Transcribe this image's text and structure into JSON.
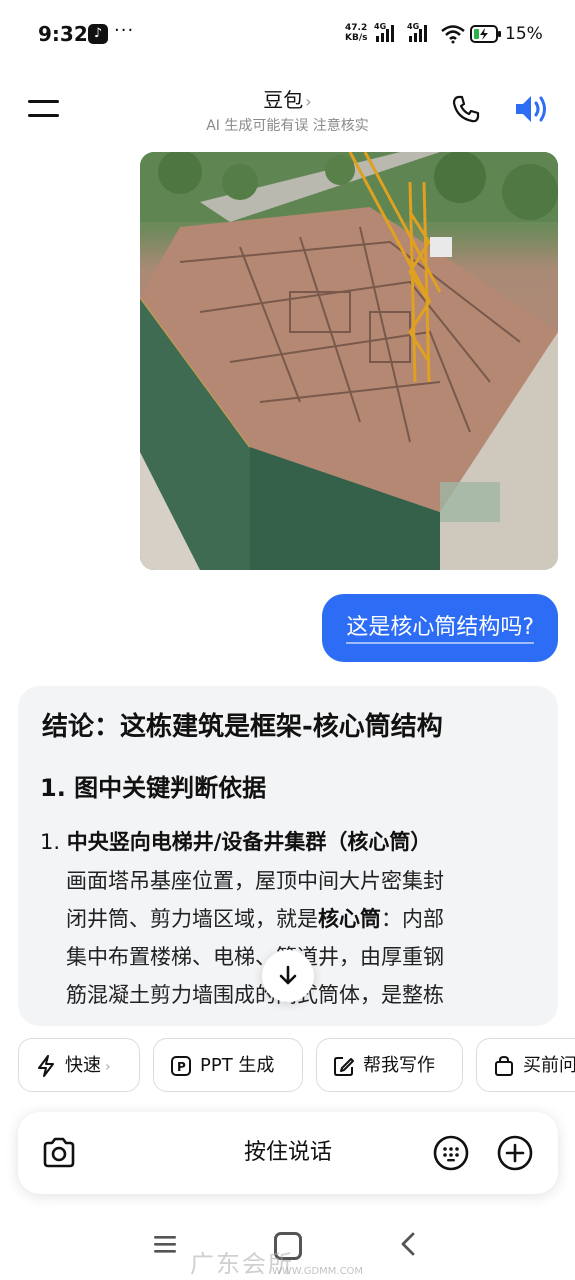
{
  "status_bar": {
    "time": "9:32",
    "more": "···",
    "net_speed_value": "47.2",
    "net_speed_unit": "KB/s",
    "signal_1_type": "4G",
    "signal_2_type": "4G",
    "battery_percent": "15%"
  },
  "header": {
    "title": "豆包",
    "title_chevron": "›",
    "subtitle": "AI 生成可能有误 注意核实",
    "accent_color": "#2d6df5"
  },
  "chat": {
    "user_message": "这是核心筒结构吗?",
    "reply": {
      "heading": "结论：这栋建筑是框架-核心筒结构",
      "section_1": "1. 图中关键判断依据",
      "item_1_number": "1. ",
      "item_1_title": "中央竖向电梯井/设备井集群（核心筒）",
      "item_1_lines": [
        {
          "text": "画面塔吊基座位置，屋顶中间大片密集封"
        },
        {
          "text": "闭井筒、剪力墙区域，就是",
          "bold": "核心筒",
          "tail": "：内部"
        },
        {
          "text": "集中布置楼梯、电梯、管道井，由厚重钢"
        },
        {
          "text": "筋混凝土剪力墙围成的闭式筒体，是整栋"
        }
      ]
    }
  },
  "chips": [
    {
      "label": "快速",
      "icon": "lightning-icon",
      "chevron": "›"
    },
    {
      "label": "PPT 生成",
      "icon": "ppt-icon"
    },
    {
      "label": "帮我写作",
      "icon": "edit-icon"
    },
    {
      "label": "买前问",
      "icon": "shopping-bag-icon"
    }
  ],
  "input_bar": {
    "hold_to_talk": "按住说话"
  },
  "watermark": {
    "text": "广东会所",
    "url": "WWW.GDMM.COM"
  }
}
